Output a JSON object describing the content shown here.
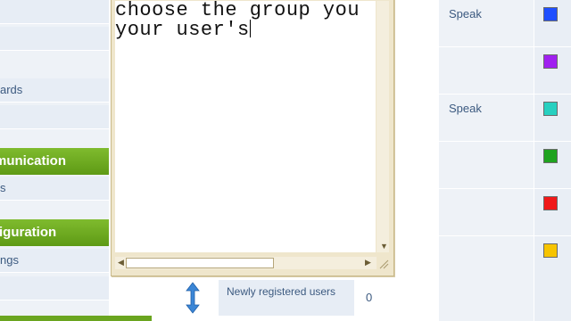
{
  "sidebar": {
    "items": [
      {
        "label": "ards",
        "type": "link"
      },
      {
        "label": "munication",
        "type": "header"
      },
      {
        "label": "s",
        "type": "link"
      },
      {
        "label": "figuration",
        "type": "header"
      },
      {
        "label": "ngs",
        "type": "link"
      }
    ]
  },
  "editor": {
    "line1": "choose the group you",
    "line2": "your user's"
  },
  "groups": {
    "rows": [
      {
        "permission": "Speak",
        "color": "#1f4fff"
      },
      {
        "permission": "",
        "color": "#a020f0"
      },
      {
        "permission": "Speak",
        "color": "#27d0c0"
      },
      {
        "permission": "",
        "color": "#1fa31f"
      },
      {
        "permission": "",
        "color": "#f01818"
      },
      {
        "permission": "",
        "color": "#f7c400"
      }
    ],
    "bottom_row": {
      "name": "Newly registered users",
      "count": "0"
    }
  }
}
